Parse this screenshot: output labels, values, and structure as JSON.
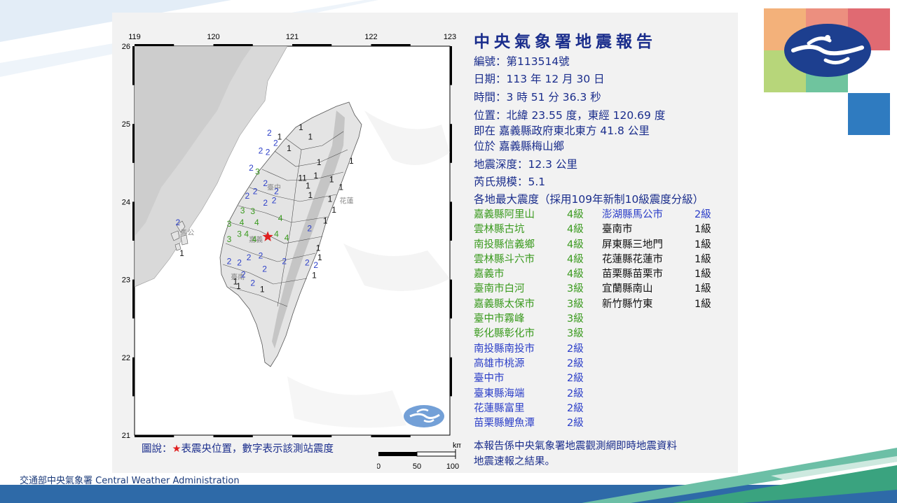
{
  "report": {
    "title": "中央氣象署地震報告",
    "number_label": "編號：",
    "number_value": "第113514號",
    "date_label": "日期：",
    "date_value": "113 年 12 月 30 日",
    "time_label": "時間：",
    "time_value": "3 時 51 分 36.3 秒",
    "location_label": "位置：",
    "location_value": "北緯 23.55 度，東經 120.69 度",
    "relative_label": "即在",
    "relative_value": "嘉義縣政府東北東方 41.8 公里",
    "township_label": "位於",
    "township_value": "嘉義縣梅山鄉",
    "depth_label": "地震深度：",
    "depth_value": "12.3 公里",
    "magnitude_label": "芮氏規模：",
    "magnitude_value": "5.1",
    "intensity_heading": "各地最大震度（採用109年新制10級震度分級）",
    "note_line1": "本報告係中央氣象署地震觀測網即時地震資料",
    "note_line2": "地震速報之結果。"
  },
  "intensities_col1": [
    {
      "name": "嘉義縣阿里山",
      "level": "4級",
      "color": "#3a9a1e"
    },
    {
      "name": "雲林縣古坑",
      "level": "4級",
      "color": "#3a9a1e"
    },
    {
      "name": "南投縣信義鄉",
      "level": "4級",
      "color": "#3a9a1e"
    },
    {
      "name": "雲林縣斗六市",
      "level": "4級",
      "color": "#3a9a1e"
    },
    {
      "name": "嘉義市",
      "level": "4級",
      "color": "#3a9a1e"
    },
    {
      "name": "臺南市白河",
      "level": "3級",
      "color": "#3a9a1e"
    },
    {
      "name": "嘉義縣太保市",
      "level": "3級",
      "color": "#3a9a1e"
    },
    {
      "name": "臺中市霧峰",
      "level": "3級",
      "color": "#3a9a1e"
    },
    {
      "name": "彰化縣彰化市",
      "level": "3級",
      "color": "#3a9a1e"
    },
    {
      "name": "南投縣南投市",
      "level": "2級",
      "color": "#2c3fc8"
    },
    {
      "name": "高雄市桃源",
      "level": "2級",
      "color": "#2c3fc8"
    },
    {
      "name": "臺中市",
      "level": "2級",
      "color": "#2c3fc8"
    },
    {
      "name": "臺東縣海端",
      "level": "2級",
      "color": "#2c3fc8"
    },
    {
      "name": "花蓮縣富里",
      "level": "2級",
      "color": "#2c3fc8"
    },
    {
      "name": "苗栗縣鯉魚潭",
      "level": "2級",
      "color": "#2c3fc8"
    }
  ],
  "intensities_col2": [
    {
      "name": "澎湖縣馬公市",
      "level": "2級",
      "color": "#2c3fc8"
    },
    {
      "name": "臺南市",
      "level": "1級",
      "color": "#111111"
    },
    {
      "name": "屏東縣三地門",
      "level": "1級",
      "color": "#111111"
    },
    {
      "name": "花蓮縣花蓮市",
      "level": "1級",
      "color": "#111111"
    },
    {
      "name": "苗栗縣苗栗市",
      "level": "1級",
      "color": "#111111"
    },
    {
      "name": "宜蘭縣南山",
      "level": "1級",
      "color": "#111111"
    },
    {
      "name": "新竹縣竹東",
      "level": "1級",
      "color": "#111111"
    }
  ],
  "map": {
    "lon_labels": [
      "119",
      "120",
      "121",
      "122",
      "123"
    ],
    "lat_labels": [
      "26",
      "25",
      "24",
      "23",
      "22",
      "21"
    ],
    "legend_prefix": "圖說：",
    "legend_star": "★",
    "legend_text": "表震央位置，數字表示該測站震度",
    "scale_unit": "km",
    "scale_labels": [
      "0",
      "50",
      "100"
    ],
    "epicenter": {
      "lon": 120.69,
      "lat": 23.55
    },
    "station_labels": [
      {
        "text": "臺中",
        "lon": 120.68,
        "lat": 24.15
      },
      {
        "text": "花蓮",
        "lon": 121.6,
        "lat": 23.98
      },
      {
        "text": "嘉義",
        "lon": 120.45,
        "lat": 23.48
      },
      {
        "text": "臺南",
        "lon": 120.22,
        "lat": 23.0
      },
      {
        "text": "馬公",
        "lon": 119.58,
        "lat": 23.57
      }
    ],
    "stations": [
      {
        "v": "1",
        "lon": 121.11,
        "lat": 24.92
      },
      {
        "v": "1",
        "lon": 121.23,
        "lat": 24.8
      },
      {
        "v": "1",
        "lon": 120.84,
        "lat": 24.8
      },
      {
        "v": "1",
        "lon": 120.96,
        "lat": 24.65
      },
      {
        "v": "1",
        "lon": 121.34,
        "lat": 24.47
      },
      {
        "v": "1",
        "lon": 121.75,
        "lat": 24.49
      },
      {
        "v": "1",
        "lon": 121.3,
        "lat": 24.3
      },
      {
        "v": "1",
        "lon": 121.5,
        "lat": 24.25
      },
      {
        "v": "1",
        "lon": 121.62,
        "lat": 24.15
      },
      {
        "v": "1",
        "lon": 121.2,
        "lat": 24.17
      },
      {
        "v": "1",
        "lon": 121.23,
        "lat": 24.05
      },
      {
        "v": "1",
        "lon": 121.48,
        "lat": 24.0
      },
      {
        "v": "1",
        "lon": 121.53,
        "lat": 23.86
      },
      {
        "v": "1",
        "lon": 121.42,
        "lat": 23.72
      },
      {
        "v": "1",
        "lon": 121.33,
        "lat": 23.37
      },
      {
        "v": "1",
        "lon": 121.35,
        "lat": 23.25
      },
      {
        "v": "1",
        "lon": 121.28,
        "lat": 23.02
      },
      {
        "v": "1",
        "lon": 120.32,
        "lat": 22.88
      },
      {
        "v": "1",
        "lon": 120.62,
        "lat": 22.84
      },
      {
        "v": "1",
        "lon": 120.28,
        "lat": 22.94
      },
      {
        "v": "1",
        "lon": 119.6,
        "lat": 23.3
      },
      {
        "v": "11",
        "lon": 121.13,
        "lat": 24.27
      },
      {
        "v": "2",
        "lon": 120.71,
        "lat": 24.85
      },
      {
        "v": "2",
        "lon": 120.79,
        "lat": 24.72
      },
      {
        "v": "2",
        "lon": 120.6,
        "lat": 24.62
      },
      {
        "v": "2",
        "lon": 120.69,
        "lat": 24.6
      },
      {
        "v": "2",
        "lon": 120.48,
        "lat": 24.4
      },
      {
        "v": "2",
        "lon": 120.66,
        "lat": 24.2
      },
      {
        "v": "2",
        "lon": 120.53,
        "lat": 24.1
      },
      {
        "v": "2",
        "lon": 120.43,
        "lat": 24.04
      },
      {
        "v": "2",
        "lon": 120.66,
        "lat": 23.95
      },
      {
        "v": "2",
        "lon": 120.77,
        "lat": 23.98
      },
      {
        "v": "2",
        "lon": 120.8,
        "lat": 24.1
      },
      {
        "v": "2",
        "lon": 121.22,
        "lat": 23.62
      },
      {
        "v": "2",
        "lon": 121.3,
        "lat": 23.15
      },
      {
        "v": "2",
        "lon": 121.19,
        "lat": 23.18
      },
      {
        "v": "2",
        "lon": 120.9,
        "lat": 23.2
      },
      {
        "v": "2",
        "lon": 120.6,
        "lat": 23.27
      },
      {
        "v": "2",
        "lon": 120.45,
        "lat": 23.25
      },
      {
        "v": "2",
        "lon": 120.33,
        "lat": 23.18
      },
      {
        "v": "2",
        "lon": 120.2,
        "lat": 23.2
      },
      {
        "v": "2",
        "lon": 120.38,
        "lat": 23.03
      },
      {
        "v": "2",
        "lon": 120.5,
        "lat": 22.92
      },
      {
        "v": "2",
        "lon": 120.65,
        "lat": 23.1
      },
      {
        "v": "2",
        "lon": 119.55,
        "lat": 23.7
      },
      {
        "v": "3",
        "lon": 120.56,
        "lat": 24.35
      },
      {
        "v": "3",
        "lon": 120.37,
        "lat": 23.85
      },
      {
        "v": "3",
        "lon": 120.2,
        "lat": 23.68
      },
      {
        "v": "3",
        "lon": 120.5,
        "lat": 23.84
      },
      {
        "v": "3",
        "lon": 120.33,
        "lat": 23.55
      },
      {
        "v": "3",
        "lon": 120.2,
        "lat": 23.48
      },
      {
        "v": "4",
        "lon": 120.36,
        "lat": 23.7
      },
      {
        "v": "4",
        "lon": 120.55,
        "lat": 23.7
      },
      {
        "v": "4",
        "lon": 120.85,
        "lat": 23.75
      },
      {
        "v": "4",
        "lon": 120.52,
        "lat": 23.48
      },
      {
        "v": "4",
        "lon": 120.8,
        "lat": 23.55
      },
      {
        "v": "4",
        "lon": 120.93,
        "lat": 23.5
      },
      {
        "v": "4",
        "lon": 120.42,
        "lat": 23.55
      }
    ]
  },
  "footer": {
    "agency": "交通部中央氣象署 Central Weather Administration"
  },
  "colors": {
    "int1": "#111111",
    "int2": "#2c3fc8",
    "int3": "#3a9a1e",
    "int4": "#3a9a1e",
    "title": "#1a2d8c",
    "epicenter": "#e02020"
  }
}
